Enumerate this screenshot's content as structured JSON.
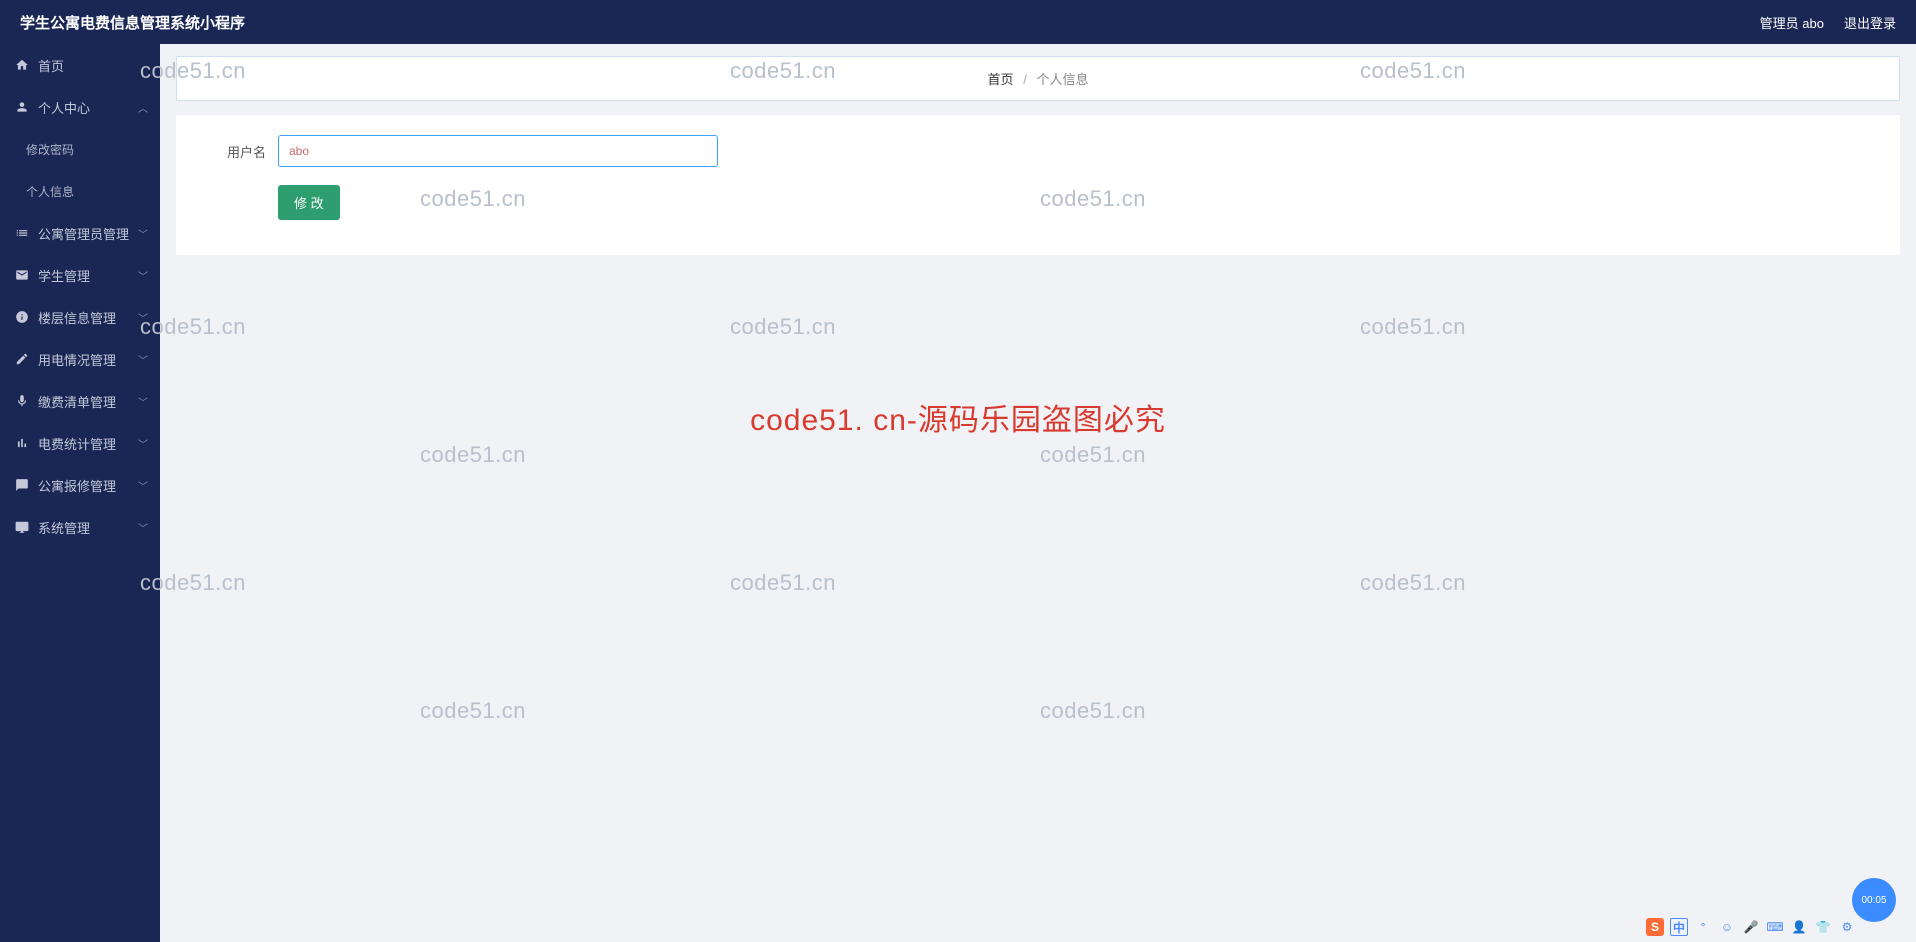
{
  "header": {
    "title": "学生公寓电费信息管理系统小程序",
    "admin_label": "管理员 abo",
    "logout_label": "退出登录"
  },
  "sidebar": {
    "home": "首页",
    "personal_center": "个人中心",
    "change_password": "修改密码",
    "personal_info": "个人信息",
    "admin_mgmt": "公寓管理员管理",
    "student_mgmt": "学生管理",
    "floor_mgmt": "楼层信息管理",
    "usage_mgmt": "用电情况管理",
    "payment_mgmt": "缴费清单管理",
    "stats_mgmt": "电费统计管理",
    "repair_mgmt": "公寓报修管理",
    "system_mgmt": "系统管理"
  },
  "breadcrumb": {
    "home": "首页",
    "sep": "/",
    "current": "个人信息"
  },
  "form": {
    "username_label": "用户名",
    "username_value": "abo",
    "submit_label": "修 改"
  },
  "watermarks": {
    "grey": "code51.cn",
    "red": "code51. cn-源码乐园盗图必究"
  },
  "fab": {
    "text": "00:05"
  },
  "ime": {
    "s": "S",
    "zh": "中"
  }
}
